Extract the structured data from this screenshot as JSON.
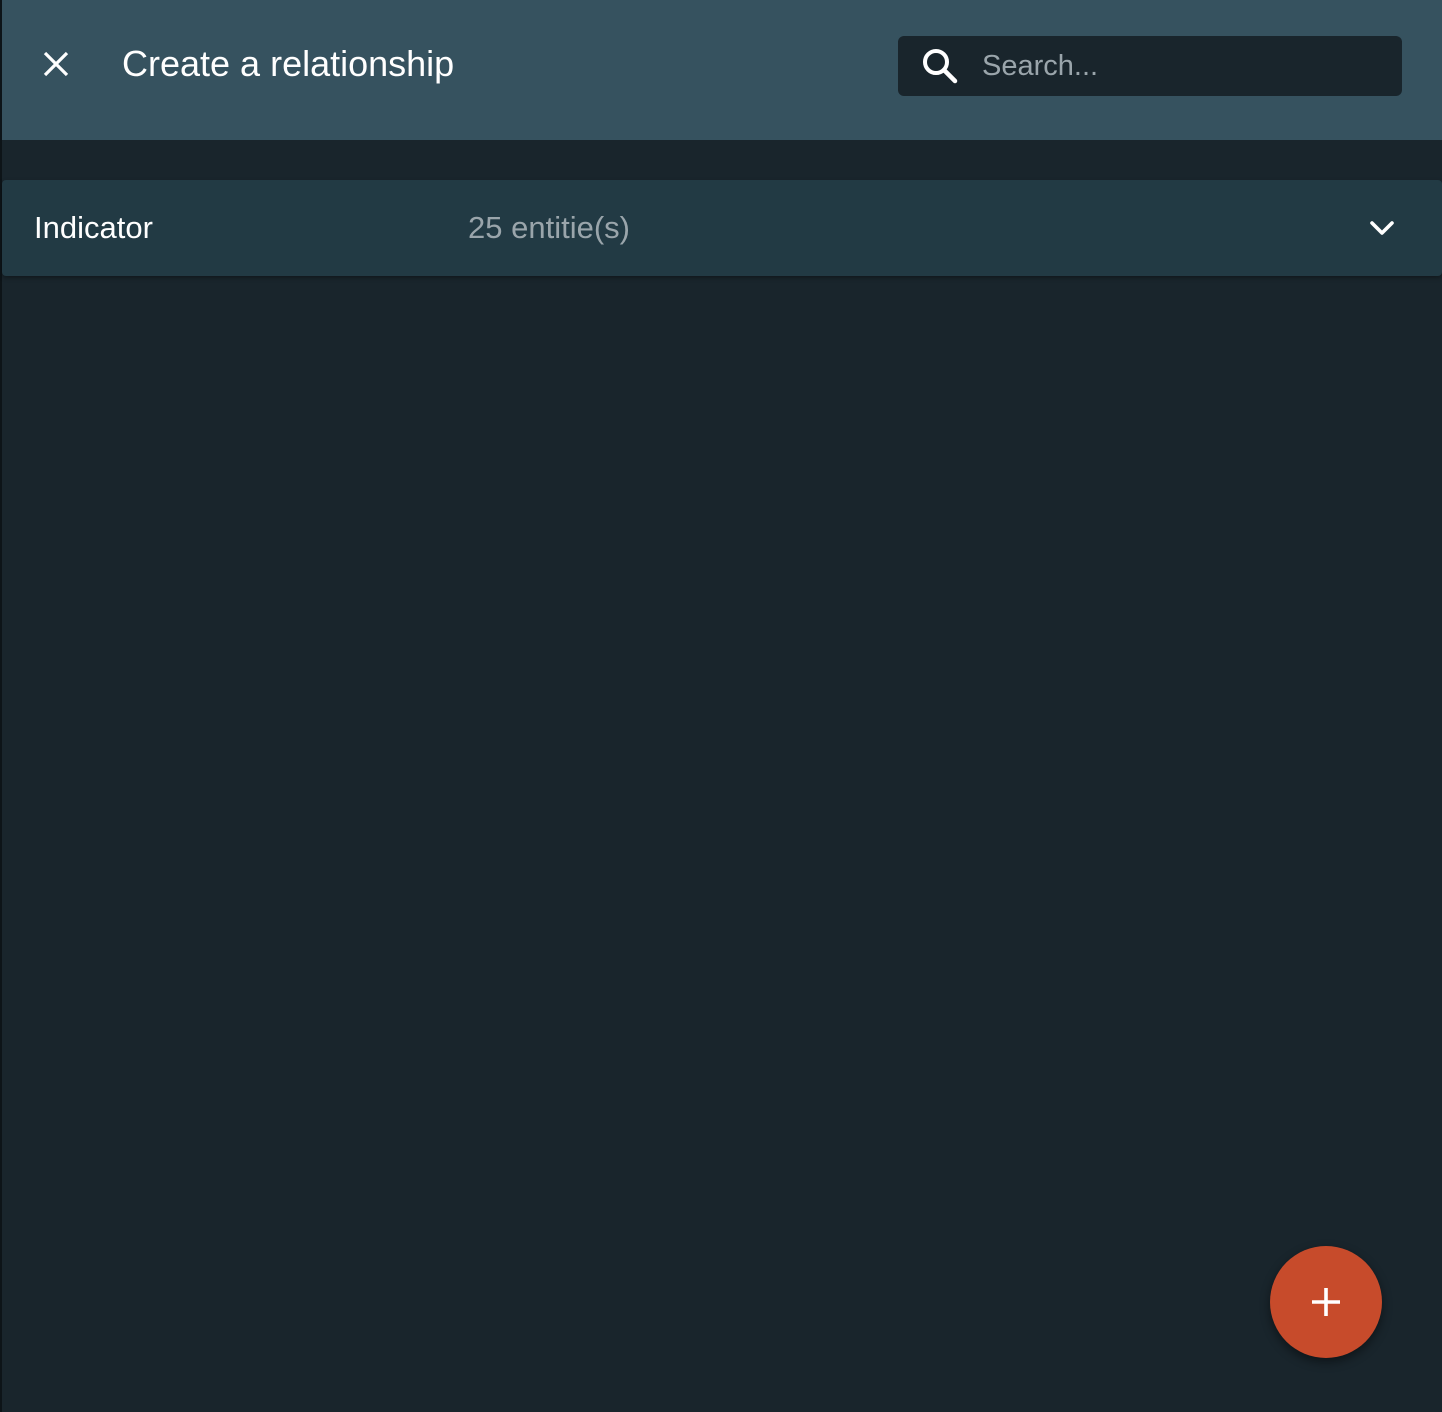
{
  "header": {
    "title": "Create a relationship",
    "close_icon": "close-icon"
  },
  "search": {
    "placeholder": "Search...",
    "value": "",
    "icon": "search-icon"
  },
  "groups": [
    {
      "label": "Indicator",
      "count_text": "25 entitie(s)",
      "expanded": false,
      "icon": "chevron-down-icon"
    }
  ],
  "fab": {
    "icon": "plus-icon",
    "color": "#c74b2b"
  },
  "colors": {
    "header_bg": "#36525f",
    "page_bg": "#19252c",
    "accordion_bg": "#223a44",
    "accent": "#c74b2b"
  }
}
